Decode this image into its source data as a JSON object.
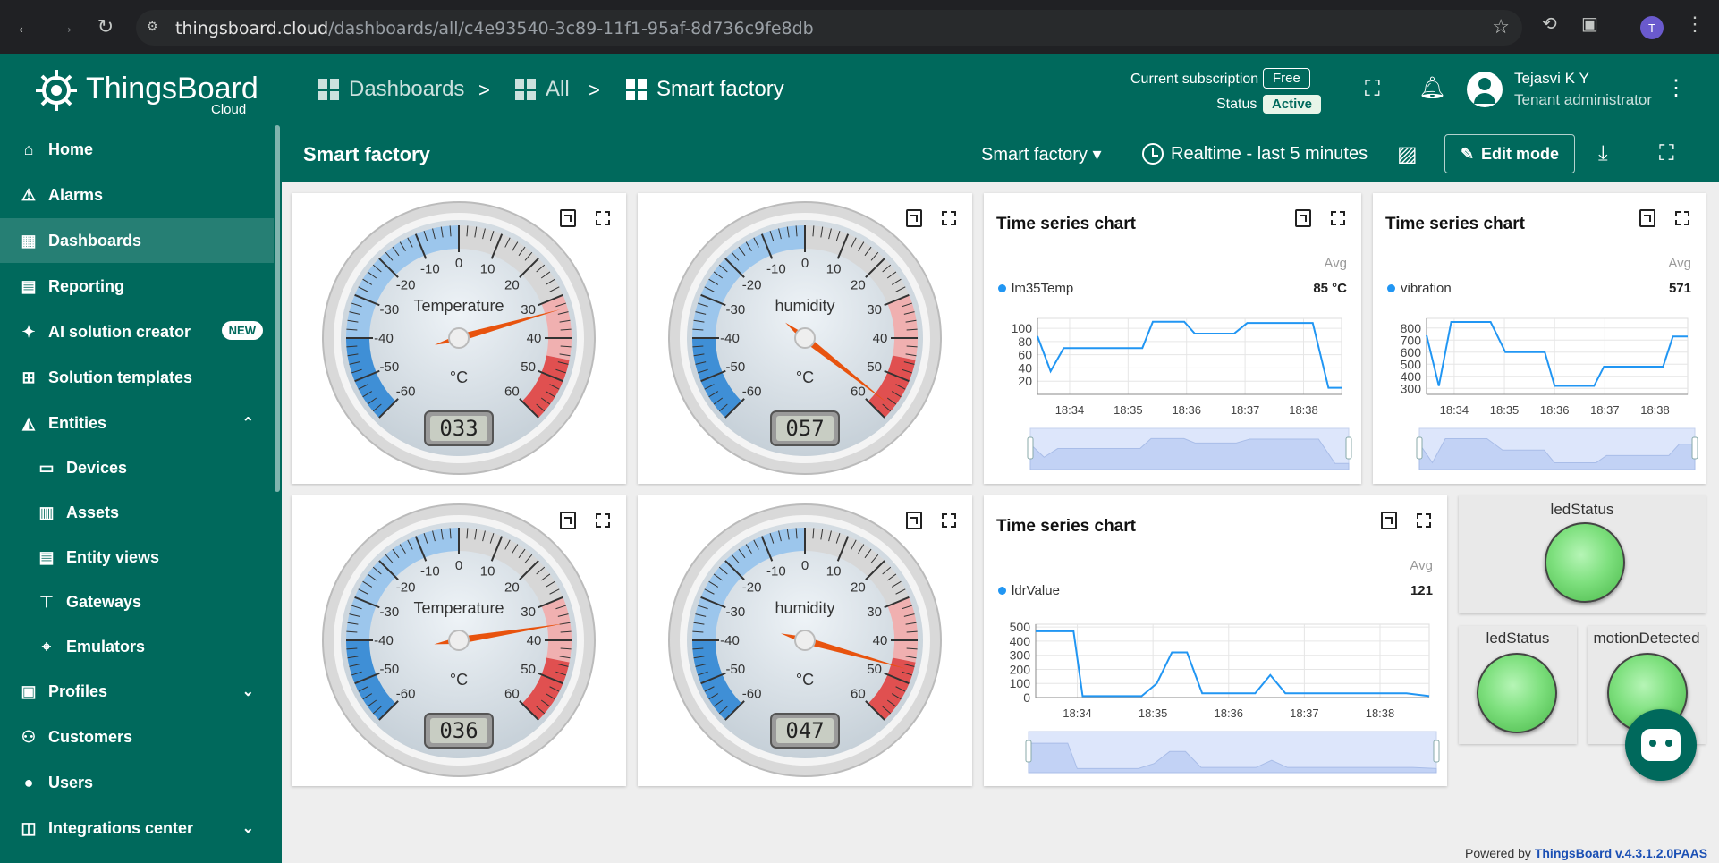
{
  "browser": {
    "url_host": "thingsboard.cloud",
    "url_path": "/dashboards/all/c4e93540-3c89-11f1-95af-8d736c9fe8db",
    "profile_initial": "T"
  },
  "header": {
    "logo_text": "ThingsBoard",
    "logo_sub": "Cloud",
    "breadcrumbs": [
      "Dashboards",
      "All",
      "Smart factory"
    ],
    "subscription_label": "Current subscription",
    "subscription_value": "Free",
    "status_label": "Status",
    "status_value": "Active",
    "user_name": "Tejasvi K Y",
    "user_role": "Tenant administrator"
  },
  "sidebar": {
    "items": [
      {
        "label": "Home",
        "icon": "home-icon"
      },
      {
        "label": "Alarms",
        "icon": "alarm-icon"
      },
      {
        "label": "Dashboards",
        "icon": "dashboard-icon"
      },
      {
        "label": "Reporting",
        "icon": "reporting-icon"
      },
      {
        "label": "AI solution creator",
        "icon": "ai-sparkle-icon",
        "badge": "NEW"
      },
      {
        "label": "Solution templates",
        "icon": "grid-icon"
      },
      {
        "label": "Entities",
        "icon": "entities-icon"
      },
      {
        "label": "Devices",
        "icon": "devices-icon"
      },
      {
        "label": "Assets",
        "icon": "assets-icon"
      },
      {
        "label": "Entity views",
        "icon": "entity-views-icon"
      },
      {
        "label": "Gateways",
        "icon": "gateway-icon"
      },
      {
        "label": "Emulators",
        "icon": "emulator-icon"
      },
      {
        "label": "Profiles",
        "icon": "profiles-icon"
      },
      {
        "label": "Customers",
        "icon": "customers-icon"
      },
      {
        "label": "Users",
        "icon": "users-icon"
      },
      {
        "label": "Integrations center",
        "icon": "integrations-icon"
      }
    ]
  },
  "dashboard": {
    "title": "Smart factory",
    "state": "Smart factory",
    "time_window": "Realtime - last 5 minutes",
    "edit_label": "Edit mode"
  },
  "gauges": [
    {
      "label": "Temperature",
      "unit": "°C",
      "value": 33,
      "display": "033"
    },
    {
      "label": "humidity",
      "unit": "°C",
      "value": 57,
      "display": "057"
    },
    {
      "label": "Temperature",
      "unit": "°C",
      "value": 36,
      "display": "036"
    },
    {
      "label": "humidity",
      "unit": "°C",
      "value": 47,
      "display": "047"
    }
  ],
  "gauge_ticks": [
    "-60",
    "-50",
    "-40",
    "-30",
    "-20",
    "-10",
    "0",
    "10",
    "20",
    "30",
    "40",
    "50",
    "60"
  ],
  "chart_data": [
    {
      "type": "line",
      "title": "Time series chart",
      "aggregate_label": "Avg",
      "series": [
        {
          "name": "lm35Temp",
          "value_label": "85 °C",
          "values": [
            88,
            35,
            70,
            70,
            70,
            70,
            110,
            110,
            110,
            92,
            92,
            92,
            92,
            108,
            108,
            108,
            108,
            108,
            108,
            10,
            10
          ]
        }
      ],
      "x_ticks": [
        "18:34",
        "18:35",
        "18:36",
        "18:37",
        "18:38"
      ],
      "x": [
        0.0,
        0.25,
        0.5,
        1.0,
        1.5,
        2.0,
        2.2,
        2.5,
        2.8,
        3.0,
        3.25,
        3.5,
        3.75,
        4.0,
        4.25,
        4.5,
        4.75,
        5.0,
        5.25,
        5.55,
        5.8
      ],
      "y_ticks": [
        "20",
        "40",
        "60",
        "80",
        "100"
      ],
      "ylim": [
        0,
        115
      ]
    },
    {
      "type": "line",
      "title": "Time series chart",
      "aggregate_label": "Avg",
      "series": [
        {
          "name": "vibration",
          "value_label": "571",
          "values": [
            740,
            320,
            850,
            850,
            850,
            600,
            600,
            600,
            320,
            320,
            320,
            480,
            480,
            480,
            480,
            730,
            730
          ]
        }
      ],
      "x_ticks": [
        "18:34",
        "18:35",
        "18:36",
        "18:37",
        "18:38"
      ],
      "x": [
        0.0,
        0.25,
        0.5,
        0.9,
        1.3,
        1.6,
        2.0,
        2.4,
        2.6,
        3.0,
        3.4,
        3.6,
        4.0,
        4.4,
        4.8,
        5.0,
        5.3
      ],
      "y_ticks": [
        "300",
        "400",
        "500",
        "600",
        "700",
        "800"
      ],
      "ylim": [
        250,
        880
      ]
    },
    {
      "type": "line",
      "title": "Time series chart",
      "aggregate_label": "Avg",
      "series": [
        {
          "name": "ldrValue",
          "value_label": "121",
          "values": [
            470,
            470,
            470,
            10,
            10,
            10,
            100,
            320,
            320,
            30,
            30,
            30,
            160,
            30,
            30,
            30,
            30,
            30,
            10
          ]
        }
      ],
      "x_ticks": [
        "18:34",
        "18:35",
        "18:36",
        "18:37",
        "18:38"
      ],
      "x": [
        0.0,
        0.3,
        0.5,
        0.62,
        1.0,
        1.4,
        1.6,
        1.8,
        2.0,
        2.2,
        2.5,
        2.9,
        3.1,
        3.3,
        3.7,
        4.1,
        4.5,
        4.9,
        5.2
      ],
      "y_ticks": [
        "0",
        "100",
        "200",
        "300",
        "400",
        "500"
      ],
      "ylim": [
        0,
        520
      ]
    }
  ],
  "leds": [
    {
      "title": "ledStatus"
    },
    {
      "title": "ledStatus"
    },
    {
      "title": "motionDetected"
    }
  ],
  "footer": {
    "prefix": "Powered by ",
    "link": "ThingsBoard v.4.3.1.2.0PAAS"
  }
}
